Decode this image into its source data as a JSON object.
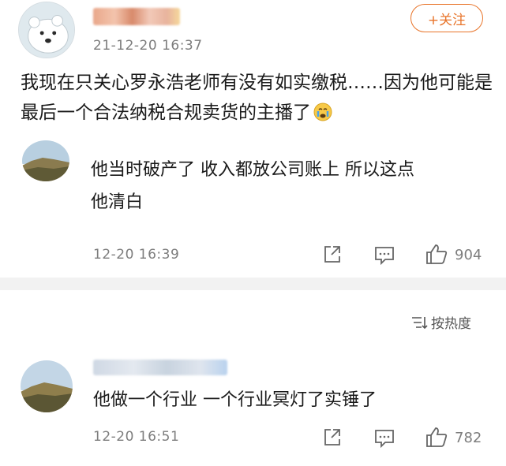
{
  "top_comment": {
    "avatar": "polar-bear-avatar",
    "time": "21-12-20 16:37",
    "follow_label": "+关注",
    "text": "我现在只关心罗永浩老师有没有如实缴税……因为他可能是最后一个合法纳税合规卖货的主播了"
  },
  "replies": [
    {
      "avatar": "landscape-avatar",
      "text_line1": "他当时破产了 收入都放公司账上 所以这点",
      "text_line2": "他清白",
      "time": "12-20 16:39",
      "likes": "904"
    }
  ],
  "sort_label": "按热度",
  "second_comment": {
    "avatar": "landscape-avatar",
    "text": "他做一个行业 一个行业冥灯了实锤了",
    "time": "12-20 16:51",
    "likes": "782"
  },
  "colors": {
    "accent": "#e8742a",
    "muted": "#7d7d7d",
    "divider": "#f2f2f2"
  }
}
